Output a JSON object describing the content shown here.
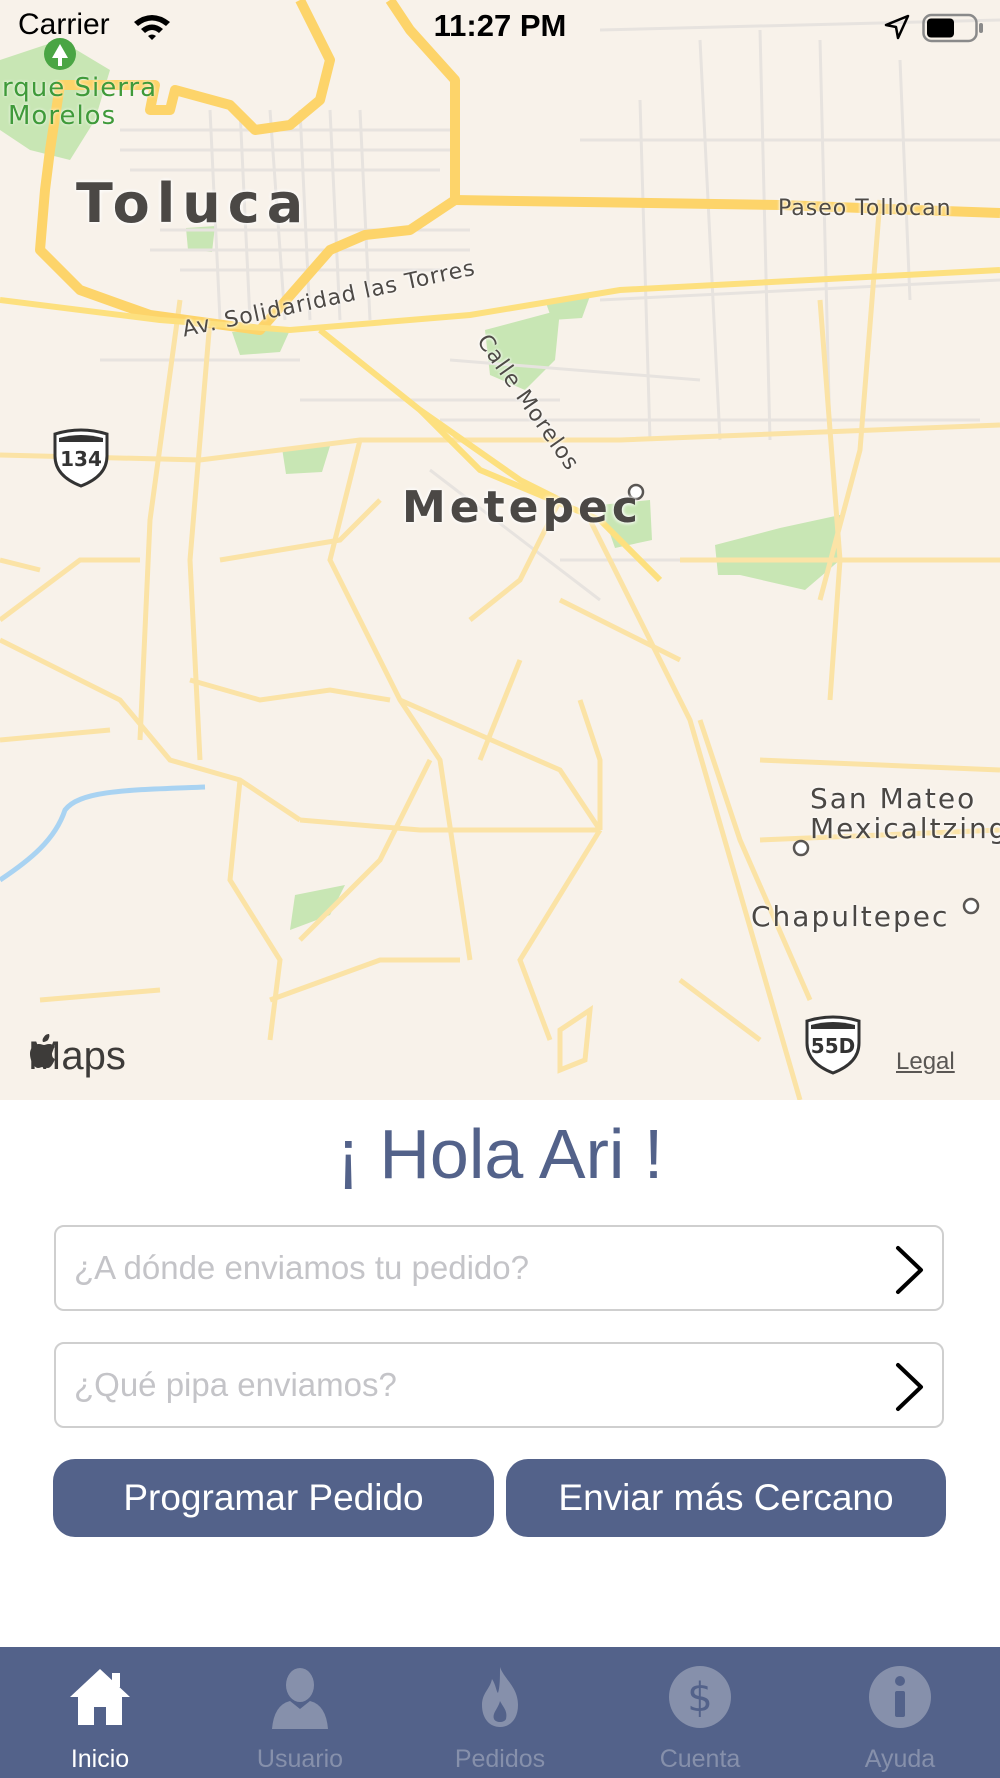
{
  "status_bar": {
    "carrier": "Carrier",
    "time": "11:27 PM"
  },
  "map": {
    "labels": {
      "toluca": "Toluca",
      "metepec": "Metepec",
      "park_line1": "rque Sierra",
      "park_line2": "Morelos",
      "paseo_tollocan": "Paseo Tollocan",
      "av_solidaridad": "Av. Solidaridad las Torres",
      "calle_morelos": "Calle Morelos",
      "san_mateo_line1": "San Mateo",
      "san_mateo_line2": "Mexicaltzing",
      "chapultepec": "Chapultepec",
      "route_134": "134",
      "route_55d": "55D"
    },
    "attribution": "Maps",
    "legal": "Legal",
    "colors": {
      "land": "#f8f2ea",
      "major_road": "#fdd46a",
      "road": "#fbe3a6",
      "park": "#c8e6b4",
      "water": "#a9d3f2"
    }
  },
  "greeting": "¡ Hola Ari !",
  "fields": {
    "destination_placeholder": "¿A dónde enviamos tu pedido?",
    "pipa_placeholder": "¿Qué pipa enviamos?"
  },
  "buttons": {
    "schedule": "Programar Pedido",
    "nearest": "Enviar más Cercano"
  },
  "tabbar": {
    "active_index": 0,
    "items": [
      {
        "label": "Inicio",
        "icon": "home-icon"
      },
      {
        "label": "Usuario",
        "icon": "user-icon"
      },
      {
        "label": "Pedidos",
        "icon": "flame-icon"
      },
      {
        "label": "Cuenta",
        "icon": "dollar-icon"
      },
      {
        "label": "Ayuda",
        "icon": "info-icon"
      }
    ]
  },
  "colors": {
    "accent": "#53628a",
    "tab_inactive": "#8690ab"
  }
}
